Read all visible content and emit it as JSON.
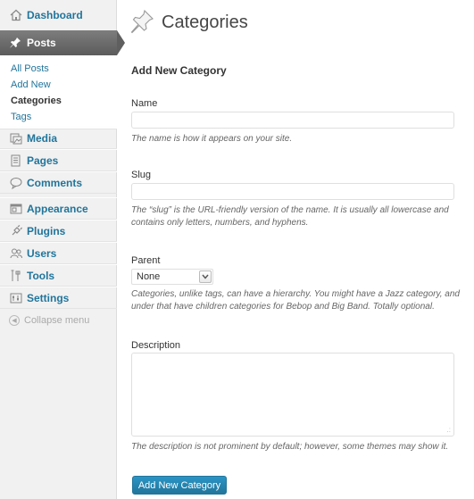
{
  "sidebar": {
    "dashboard": {
      "label": "Dashboard",
      "icon": "home-icon"
    },
    "posts": {
      "label": "Posts",
      "icon": "pushpin-icon",
      "submenu": [
        "All Posts",
        "Add New",
        "Categories",
        "Tags"
      ],
      "current": "Categories"
    },
    "items": [
      {
        "label": "Media",
        "icon": "media-icon"
      },
      {
        "label": "Pages",
        "icon": "pages-icon"
      },
      {
        "label": "Comments",
        "icon": "comment-icon"
      },
      {
        "label": "Appearance",
        "icon": "appearance-icon"
      },
      {
        "label": "Plugins",
        "icon": "plugin-icon"
      },
      {
        "label": "Users",
        "icon": "users-icon"
      },
      {
        "label": "Tools",
        "icon": "tools-icon"
      },
      {
        "label": "Settings",
        "icon": "settings-icon"
      }
    ],
    "collapse_label": "Collapse menu"
  },
  "main": {
    "title": "Categories",
    "title_icon": "pushpin-icon",
    "form_title": "Add New Category",
    "name": {
      "label": "Name",
      "value": "",
      "help": "The name is how it appears on your site."
    },
    "slug": {
      "label": "Slug",
      "value": "",
      "help": "The “slug” is the URL-friendly version of the name. It is usually all lowercase and contains only letters, numbers, and hyphens."
    },
    "parent": {
      "label": "Parent",
      "selected": "None",
      "help": "Categories, unlike tags, can have a hierarchy. You might have a Jazz category, and under that have children categories for Bebop and Big Band. Totally optional."
    },
    "description": {
      "label": "Description",
      "value": "",
      "help": "The description is not prominent by default; however, some themes may show it."
    },
    "submit_label": "Add New Category"
  },
  "colors": {
    "link": "#21759b",
    "sidebar_bg": "#f1f1f1",
    "active_menu": "#5b5b5b",
    "button": "#21759b"
  }
}
